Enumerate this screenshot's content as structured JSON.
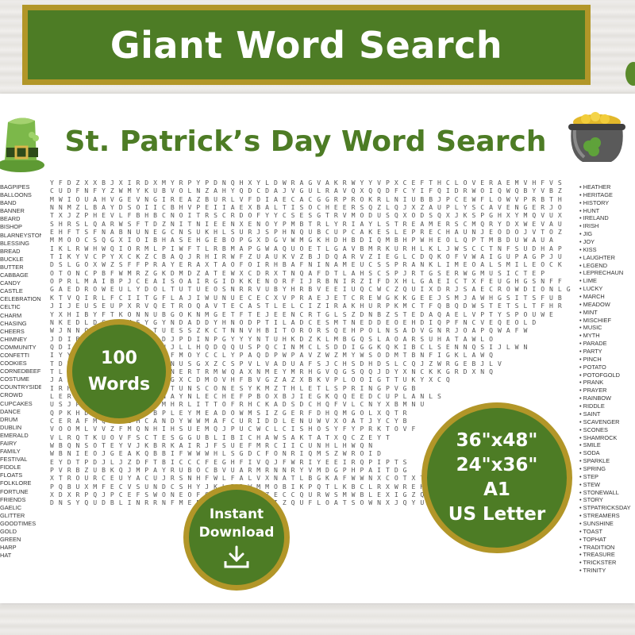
{
  "banner": {
    "title": "Giant Word Search"
  },
  "poster": {
    "title": "St. Patrick’s Day Word Search"
  },
  "grid_rows": [
    "Y F D Z X X B J X I R D X M Y R P Y P D N Q H X Y L D W R A G V A K R W Y Y V P X C E F T H C L O V E R A E M V H F V S",
    "C U D F N F Y Z W M Y K U B V O L N Z A H Y Q D C D A J V G U L R A V Q X Q Q D F C Y I F Q I D R W O I Q W Q B Y V B Z",
    "M W I O U A H V G E V N G I R E A Z B U R L V F D I A E C A C G G R P R O K R L N I U B B J P C E W F L O W V P R B T H",
    "N N M Z L B A Y D S O I I C B H V P E I I A E X B A L T I S O C H E E R S Q Z L Q J X Z A U P L Y S C A V E N G E R J O",
    "T X J Z P H E V L F B H B C N O I T R S C R D O F Y Y C S E S G T R V M O D U S Q X O D S Q X J K S P G H X Y M Q V U X",
    "S H R S L Q A R W S F T D Z N I T N I E E N X E N O Y P M B T R L Y R I A Y L S T R E A M E R S C M Q R Y D X W E V A U",
    "E H F T S F N A B N U N E G C N S U K H L S U R J S P H N Q U B C U P C A K E S L E P R E C H A U N J E O D O J V T O Z",
    "M M O O C S Q G X I O I B H A S E H G E B O P G X D G V W M G K H D H B D I Q M B H P W H E O L Q P T M B D U W A U A",
    "I K L R W H W Q I O R M L P I W F T L R B M A P G W A Q U O E T L G A V B M R K U R H L K L J W S C C T N F S U D H A P",
    "T I K Y V C P Y X C K Z C B A Q J R H I R W F Z U A U K V Z B J D Q A R V Z I E G L C D Q K O F V W A I G U P A G P J U",
    "D S L G O X W Z S F F P R A Y E R A X T A O F O I R H B A F N I N A M E U C S S P R A N K L I M E O A L S M I L E O C K",
    "O T O N C P B F W M R Z G K D M D Z A T E W X C D R X T N Q A F D T L A H S C S P J R T G S E R W G M U S I C T E P",
    "O P R L M A I B P J C E A I S O A I R G I D K K E N O R F I J R B N I R Z I F D X H L G A E I C T X F E U G H G S N F F",
    "G A E D R O W E U L Y D O L T U T U E O S N R R V U B Y H R B V E E I U Q C W C Z Q U I X D R J S A E C R O W D I O N L G",
    "K T V Q I R L F C I I T G F L A J I W U N U E C E C X V P R A E J E T C R E W G K K G E E J S M J A W H G S I T S F U B",
    "J I J E U S E U P X R V Q E T R O Q A V T E C A S T L E L C I Z I R A K H U R P K M C T F Q B Q D W S T E T S L T F H R",
    "Y X H I B Y F T K O N N U B G O K N M G E T F T E J E E N C R T G L S Z D N B Z S T E D A Q A E L V P T Y S P O U W E",
    "N K E D L D G J Q M S Y G Y N D A D D Y H N O D P T I L A D C E S M T N E D D E O E H D I Q P F N C V E Q E O L D",
    "W J N N O J L C P J D V T U E S S Z K C T N N V H B I T O R O R S Q E H P O L N S A D V G N R J O A P Q W A F W",
    "J D I B L F Q X I T O P F D J P D I N P G Y Y Y N T U H K D Z K L M B G Q S L A O A R S U H A T A W L O",
    "Q D I J G L Q H X Z T G G H J L L H Q D Q Q U S P Q C I N M C L S D D I G G K Q K I B C L S E N N Q S I J L W N",
    "I Y Y Y Y A Q Z B G H W I Z F M O Y C C L Y P A Q D P W P A V Z W Z M Y W S O D M T B N F I G K L A W Q",
    "T D N A K B H N X B I W A F N U S G X Z C S P V L V A D U A F S J C H S D H D S L C Q J Z W R G E B J L V",
    "T L C O R N B H P M N B A N N E R T R M W Q A X N M E Y M R H G V Q G S Q Q J D Y X N C K K G R D X N Q",
    "J A K W W P E T A A O Z A Z G X C D M O V H F B V G Z A Z X B K V P L O O I G T T U K Y X C Q",
    "I R H F I P A H X C P Z P D T U N S C O N E S Y K M Z T H L E T L S P R I N G P V G B",
    "L E R W R E C P W E R I M N A Y N L E C H E F P B O X B J I E G K Q Q E E D C U P L A N L S",
    "U S J P R X T S I D N Z V M H R L I T T O F R H C K A D S D C H Q F V L C N Y X B M N U",
    "Q P K H D N O I O Y G U B P L E Y M E A D O W M S I Z G E R F D H Q M G O L X Q T R",
    "C E R A F M Q J D G H C A N D Y W W M A F C U R I D D L E N U W V X O A T J Y C Y B",
    "V O O M L V V Z F M Q N H I H S U E M Q J P U C W C L C I S H O S Y F Y P R K T O V F",
    "V L R Q T K U O V F S C T E S G G U B L I B I C H A W S A K T A T X Q C Z E Y T",
    "W B Q N S O T E Y V J K B R K A I R J F S U E F M R C I I C U N H L H W Q N",
    "W B N I E O J G E A K Q B B I F W W W H L S G D C F O N R I Q M S Z W R O I D",
    "E Y D T P D J L J Z D F T B I C C C F E G H F I V Q J F W R I Y E E I R Q P I P T S",
    "P V R B Z U B K Q J M P A Y R U B O C B V U A R M R N N R Y V M D G P H P A I T D G",
    "X T R O U R C E U Y A C U J R S N H F W L F A L V X N A T L B G K A F W W N X C O T X T I H W F A Q J P I H H",
    "P Q B U X M F E C V S U N D C S H Y J K L B R W M M O B I K P Q T L K B C L R X W R E H Y I S Q R C O N X E E",
    "X D X R P Q J P C E F S W O N E O F O C C S M F P Z E C C Q U R W S M W B L E X I G Z Q Y D A P W F Z L U U",
    "D N S Y Q U D B L I N R R N F M E B F F A X R S I S I Z Q U F L O A T S O W N X J Q Y U L T H M B L F Z O A N J D Q"
  ],
  "left_words": [
    "BAGPIPES",
    "BALLOONS",
    "BAND",
    "BANNER",
    "BEARD",
    "BISHOP",
    "BLARNEYSTONE",
    "BLESSING",
    "BREAD",
    "BUCKLE",
    "BUTTER",
    "CABBAGE",
    "CANDY",
    "CASTLE",
    "CELEBRATION",
    "CELTIC",
    "CHARM",
    "CHASING",
    "CHEERS",
    "CHIMNEY",
    "COMMUNITY",
    "CONFETTI",
    "COOKIES",
    "CORNEDBEEF",
    "COSTUME",
    "COUNTRYSIDE",
    "CROWD",
    "CUPCAKES",
    "DANCE",
    "DRUM",
    "DUBLIN",
    "EMERALD",
    "FAIRY",
    "FAMILY",
    "FESTIVAL",
    "FIDDLE",
    "FLOATS",
    "FOLKLORE",
    "FORTUNE",
    "FRIENDS",
    "GAELIC",
    "GLITTER",
    "GOODTIMES",
    "GOLD",
    "GREEN",
    "HARP",
    "HAT"
  ],
  "right_words": [
    "HEATHER",
    "HERITAGE",
    "HISTORY",
    "HUNT",
    "IRELAND",
    "IRISH",
    "JIG",
    "JOY",
    "KISS",
    "LAUGHTER",
    "LEGEND",
    "LEPRECHAUN",
    "LIME",
    "LUCKY",
    "MARCH",
    "MEADOW",
    "MINT",
    "MISCHIEF",
    "MUSIC",
    "MYTH",
    "PARADE",
    "PARTY",
    "PINCH",
    "POTATO",
    "POTOFGOLD",
    "PRANK",
    "PRAYER",
    "RAINBOW",
    "RIDDLE",
    "SAINT",
    "SCAVENGER",
    "SCONES",
    "SHAMROCK",
    "SMILE",
    "SODA",
    "SPARKLE",
    "SPRING",
    "STEP",
    "STEW",
    "STONEWALL",
    "STORY",
    "STPATRICKSDAY",
    "STREAMERS",
    "SUNSHINE",
    "TOAST",
    "TOPHAT",
    "TRADITION",
    "TREASURE",
    "TRICKSTER",
    "TRINITY"
  ],
  "badges": {
    "words": {
      "line1": "100",
      "line2": "Words"
    },
    "download": {
      "line1": "Instant",
      "line2": "Download"
    },
    "sizes": {
      "line1": "36\"x48\"",
      "line2": "24\"x36\"",
      "line3": "A1",
      "line4": "US Letter"
    }
  },
  "colors": {
    "green": "#4d7c25",
    "gold": "#b29628"
  },
  "icons": {
    "hat": "leprechaun-hat-icon",
    "pot": "pot-of-gold-icon",
    "download": "download-icon"
  }
}
